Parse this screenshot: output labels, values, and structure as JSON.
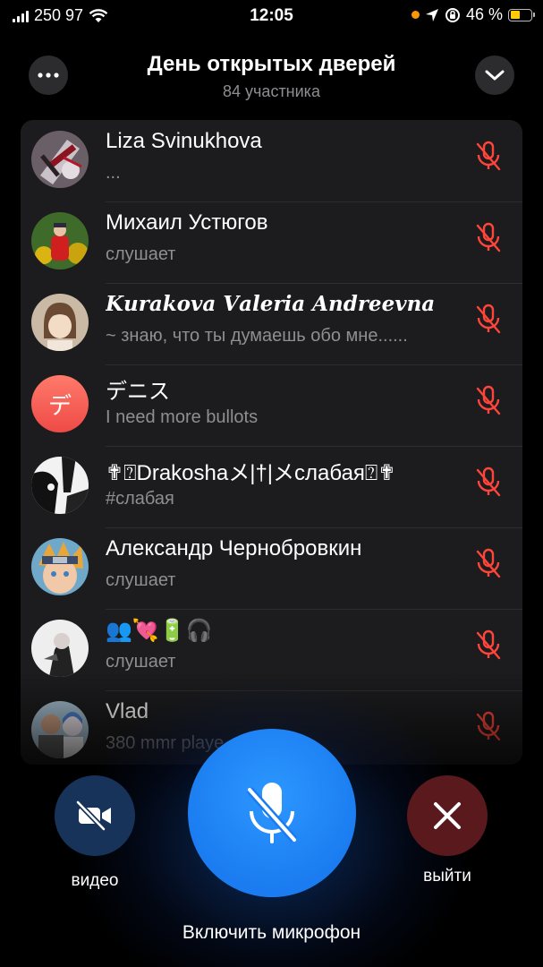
{
  "status_bar": {
    "carrier": "250 97",
    "time": "12:05",
    "battery": "46 %",
    "battery_level": 0.46
  },
  "header": {
    "title": "День открытых дверей",
    "participants": "84 участника",
    "more_icon": "ellipsis-icon",
    "collapse_icon": "chevron-down-icon"
  },
  "participants": [
    {
      "name": "Liza Svinukhova",
      "status": "...",
      "avatar": "photo"
    },
    {
      "name": "Михаил Устюгов",
      "status": "слушает",
      "avatar": "photo"
    },
    {
      "name": "𝑲𝒖𝒓𝒂𝒌𝒐𝒗𝒂 𝑽𝒂𝒍𝒆𝒓𝒊𝒂 𝑨𝒏𝒅𝒓𝒆𝒆𝒗𝒏𝒂",
      "status": "~ знаю, что ты думаешь обо мне......",
      "avatar": "photo"
    },
    {
      "name": "デニス",
      "status": "I need more bullots",
      "avatar_letter": "デ"
    },
    {
      "name": "✟⍰Drakoshaメ|†|メслабая⍰✟",
      "status": "#слабая",
      "avatar": "photo"
    },
    {
      "name": "Александр Чернобровкин",
      "status": "слушает",
      "avatar": "photo"
    },
    {
      "name": "👥💘🔋🎧",
      "status": "слушает",
      "avatar": "photo"
    },
    {
      "name": "Vlad",
      "status": "380 mmr playe",
      "avatar": "photo"
    }
  ],
  "controls": {
    "video_label": "видео",
    "leave_label": "выйти",
    "mic_caption": "Включить микрофон"
  },
  "colors": {
    "muted_red": "#ff453a",
    "mic_blue": "#1a7cf0",
    "leave_red": "#5a1a1d",
    "video_blue": "#17335a"
  }
}
